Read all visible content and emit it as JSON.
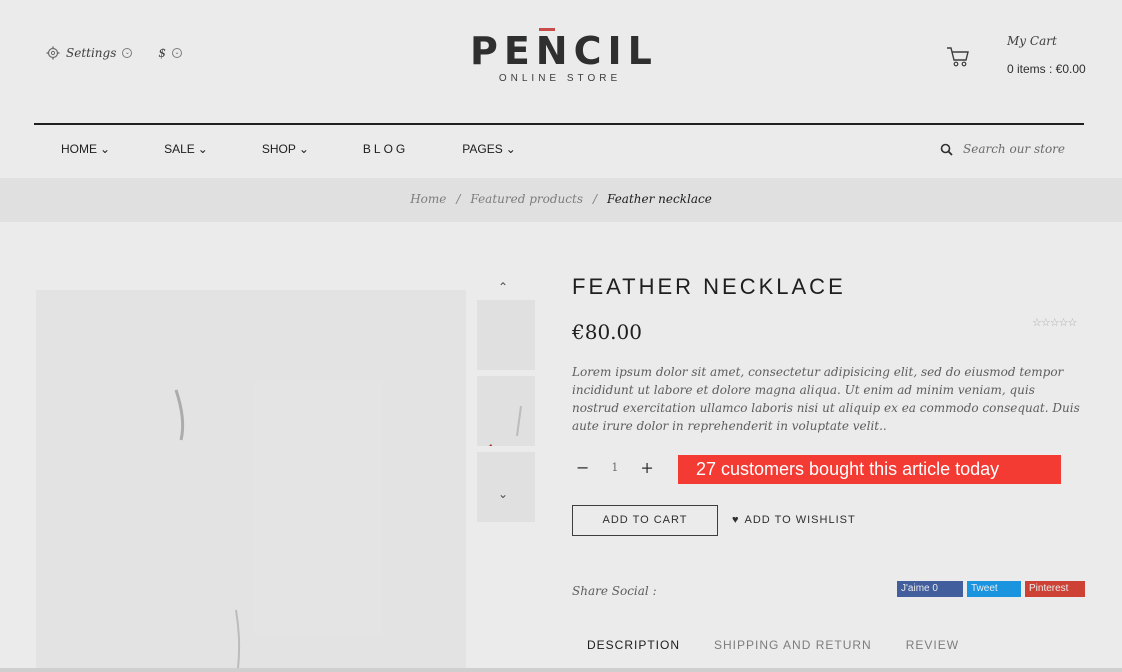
{
  "header": {
    "settings_label": "Settings",
    "currency_label": "$",
    "logo_word": "PENCIL",
    "logo_subtitle": "ONLINE STORE",
    "cart_label": "My Cart",
    "cart_summary": "0 items : €0.00"
  },
  "nav": {
    "items": [
      {
        "label": "HOME"
      },
      {
        "label": "SALE"
      },
      {
        "label": "SHOP"
      },
      {
        "label": "BLOG"
      },
      {
        "label": "PAGES"
      }
    ],
    "search_placeholder": "Search our store"
  },
  "breadcrumb": {
    "items": [
      "Home",
      "Featured products",
      "Feather necklace"
    ]
  },
  "product": {
    "title": "FEATHER NECKLACE",
    "price": "€80.00",
    "description": "Lorem ipsum dolor sit amet, consectetur adipisicing elit, sed do eiusmod tempor incididunt ut labore et dolore magna aliqua. Ut enim ad minim veniam, quis nostrud exercitation ullamco laboris nisi ut aliquip ex ea commodo consequat. Duis aute irure dolor in reprehenderit in voluptate velit..",
    "quantity": "1",
    "promo_text": "27 customers bought this article today",
    "add_to_cart": "ADD TO CART",
    "add_to_wishlist": "ADD TO WISHLIST",
    "share_label": "Share Social :",
    "social": {
      "facebook": "J'aime 0",
      "twitter": "Tweet",
      "pinterest": "Pinterest"
    }
  },
  "tabs": [
    {
      "label": "DESCRIPTION"
    },
    {
      "label": "SHIPPING AND RETURN"
    },
    {
      "label": "REVIEW"
    }
  ],
  "colors": {
    "promo_bg": "#f33b34",
    "logo_accent": "#d9534f"
  }
}
